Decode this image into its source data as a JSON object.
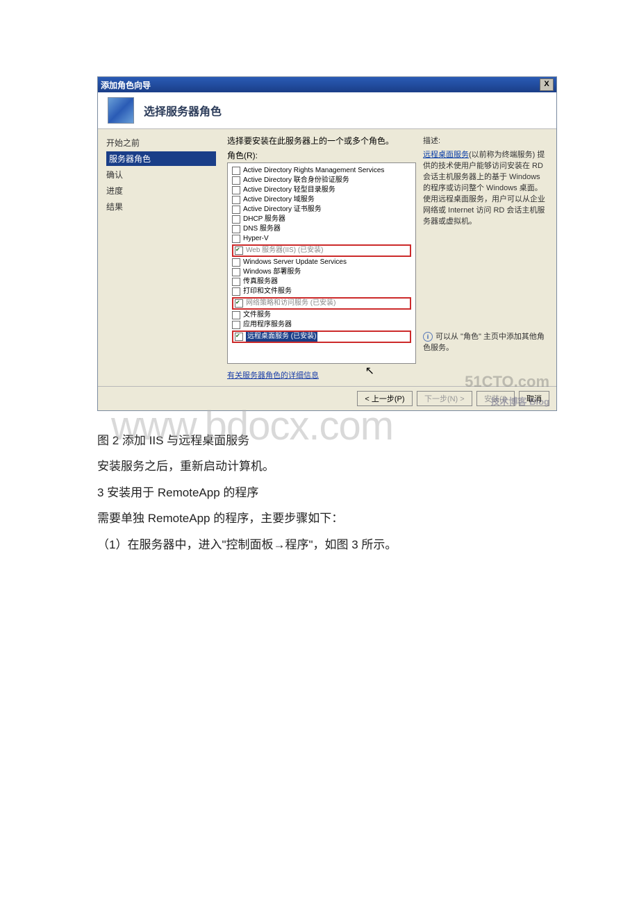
{
  "titlebar": {
    "title": "添加角色向导",
    "close": "X"
  },
  "header": {
    "title": "选择服务器角色"
  },
  "sidebar": {
    "items": [
      {
        "label": "开始之前"
      },
      {
        "label": "服务器角色"
      },
      {
        "label": "确认"
      },
      {
        "label": "进度"
      },
      {
        "label": "结果"
      }
    ]
  },
  "main": {
    "prompt": "选择要安装在此服务器上的一个或多个角色。",
    "roles_label": "角色(R):",
    "roles": [
      {
        "label": "Active Directory Rights Management Services"
      },
      {
        "label": "Active Directory 联合身份验证服务"
      },
      {
        "label": "Active Directory 轻型目录服务"
      },
      {
        "label": "Active Directory 域服务"
      },
      {
        "label": "Active Directory 证书服务"
      },
      {
        "label": "DHCP 服务器"
      },
      {
        "label": "DNS 服务器"
      },
      {
        "label": "Hyper-V"
      },
      {
        "label": "Web 服务器(IIS)",
        "suffix": "(已安装)",
        "hl": true,
        "checked": true,
        "grey": true
      },
      {
        "label": "Windows Server Update Services"
      },
      {
        "label": "Windows 部署服务"
      },
      {
        "label": "传真服务器"
      },
      {
        "label": "打印和文件服务"
      },
      {
        "label": "网络策略和访问服务",
        "suffix": "(已安装)",
        "hl": true,
        "checked": true,
        "grey": true
      },
      {
        "label": "文件服务"
      },
      {
        "label": "应用程序服务器"
      },
      {
        "label": "远程桌面服务",
        "suffix": "(已安装)",
        "hl": true,
        "checked": true,
        "selblue": true
      }
    ],
    "detail_link": "有关服务器角色的详细信息"
  },
  "desc": {
    "title": "描述:",
    "link": "远程桌面服务",
    "body": "(以前称为终端服务) 提供的技术使用户能够访问安装在 RD 会话主机服务器上的基于 Windows 的程序或访问整个 Windows 桌面。使用远程桌面服务，用户可以从企业网络或 Internet 访问 RD 会话主机服务器或虚拟机。"
  },
  "tip": {
    "text": "可以从 \"角色\" 主页中添加其他角色服务。"
  },
  "buttons": {
    "prev": "< 上一步(P)",
    "next": "下一步(N) >",
    "install": "安装(I)",
    "cancel": "取消"
  },
  "watermarks": {
    "site": "51CTO.com",
    "site_sub": "技术博客 Blog",
    "bdocx": "www.bdocx.com"
  },
  "document": {
    "caption": "图 2 添加 IIS 与远程桌面服务",
    "line1": "安装服务之后，重新启动计算机。",
    "heading": "3 安装用于 RemoteApp 的程序",
    "line2": "需要单独 RemoteApp 的程序，主要步骤如下：",
    "line3": "（1）在服务器中，进入\"控制面板→程序\"，如图 3 所示。"
  }
}
